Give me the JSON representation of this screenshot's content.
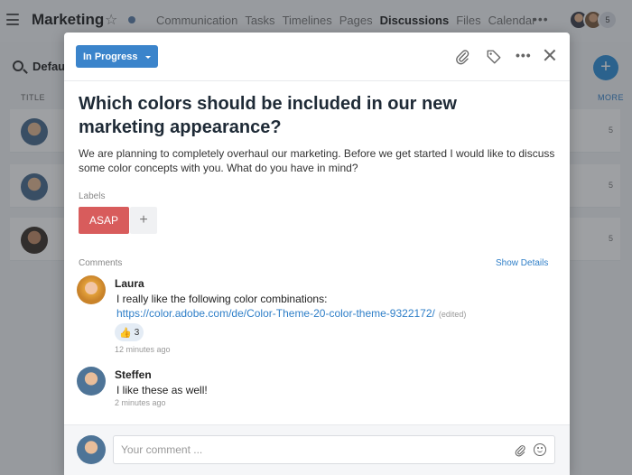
{
  "app": {
    "title": "Marketing",
    "nav": [
      "Communication",
      "Tasks",
      "Timelines",
      "Pages",
      "Discussions",
      "Files",
      "Calendar"
    ],
    "active_nav": "Discussions",
    "member_count": "5"
  },
  "list": {
    "view_label": "Defau",
    "column_title": "TITLE",
    "column_more": "MORE",
    "row_counts": [
      "5",
      "5",
      "5"
    ]
  },
  "modal": {
    "status": "In Progress",
    "title": "Which colors should be included in our new marketing appearance?",
    "description": "We are planning to completely overhaul our marketing. Before we get started I would like to discuss some color concepts with you. What do you have in mind?",
    "labels_heading": "Labels",
    "labels": [
      "ASAP"
    ],
    "add_label": "+",
    "comments_heading": "Comments",
    "show_details": "Show Details",
    "comments": [
      {
        "author": "Laura",
        "text": "I really like the following color combinations:",
        "link": "https://color.adobe.com/de/Color-Theme-20-color-theme-9322172/",
        "edited": "(edited)",
        "reaction_count": "3",
        "time": "12 minutes ago"
      },
      {
        "author": "Steffen",
        "text": "I like these as well!",
        "time": "2 minutes ago"
      }
    ],
    "composer": {
      "placeholder": "Your comment ..."
    }
  },
  "colors": {
    "accent": "#3b84cb",
    "label_asap": "#d85c5c",
    "link": "#2f7fc8"
  }
}
